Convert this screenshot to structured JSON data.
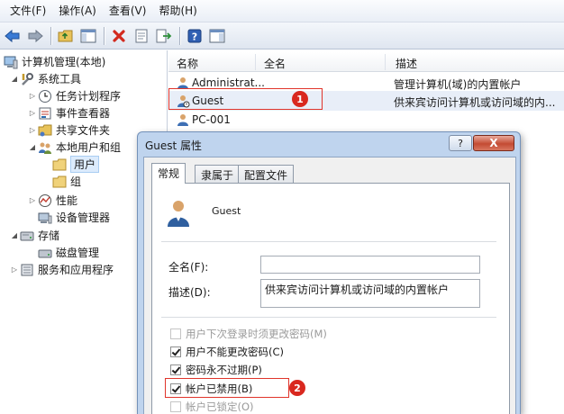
{
  "menubar": {
    "items": [
      {
        "label": "文件(F)"
      },
      {
        "label": "操作(A)"
      },
      {
        "label": "查看(V)"
      },
      {
        "label": "帮助(H)"
      }
    ]
  },
  "toolbar": {
    "buttons": [
      "back-arrow-icon",
      "forward-arrow-icon",
      "up-folder-icon",
      "show-hide-tree-icon",
      "delete-icon",
      "properties-icon",
      "export-icon",
      "help-icon",
      "action-pane-icon"
    ]
  },
  "tree": {
    "root": "计算机管理(本地)",
    "system_tools": "系统工具",
    "task_scheduler": "任务计划程序",
    "event_viewer": "事件查看器",
    "shared_folders": "共享文件夹",
    "local_users_groups": "本地用户和组",
    "users": "用户",
    "groups": "组",
    "performance": "性能",
    "device_manager": "设备管理器",
    "storage": "存储",
    "disk_management": "磁盘管理",
    "services_apps": "服务和应用程序"
  },
  "list": {
    "columns": [
      "名称",
      "全名",
      "描述"
    ],
    "rows": [
      {
        "name": "Administrat...",
        "fullname": "",
        "description": "管理计算机(域)的内置帐户"
      },
      {
        "name": "Guest",
        "fullname": "",
        "description": "供来宾访问计算机或访问域的内..."
      },
      {
        "name": "PC-001",
        "fullname": "",
        "description": ""
      }
    ]
  },
  "dialog": {
    "title": "Guest 属性",
    "help_label": "?",
    "close_label": "X",
    "tabs": [
      "常规",
      "隶属于",
      "配置文件"
    ],
    "username": "Guest",
    "fullname_label": "全名(F):",
    "fullname_value": "",
    "description_label": "描述(D):",
    "description_value": "供来宾访问计算机或访问域的内置帐户",
    "checkboxes": [
      {
        "label": "用户下次登录时须更改密码(M)",
        "checked": false,
        "enabled": false
      },
      {
        "label": "用户不能更改密码(C)",
        "checked": true,
        "enabled": true
      },
      {
        "label": "密码永不过期(P)",
        "checked": true,
        "enabled": true
      },
      {
        "label": "帐户已禁用(B)",
        "checked": true,
        "enabled": true
      },
      {
        "label": "帐户已锁定(O)",
        "checked": false,
        "enabled": false
      }
    ]
  },
  "annotations": {
    "marker_1": "1",
    "marker_2": "2",
    "color": "#d9281f"
  },
  "colors": {
    "selection": "#dcebfc",
    "dialog_frame": "#bfd4ee",
    "close_button": "#c44b33"
  }
}
